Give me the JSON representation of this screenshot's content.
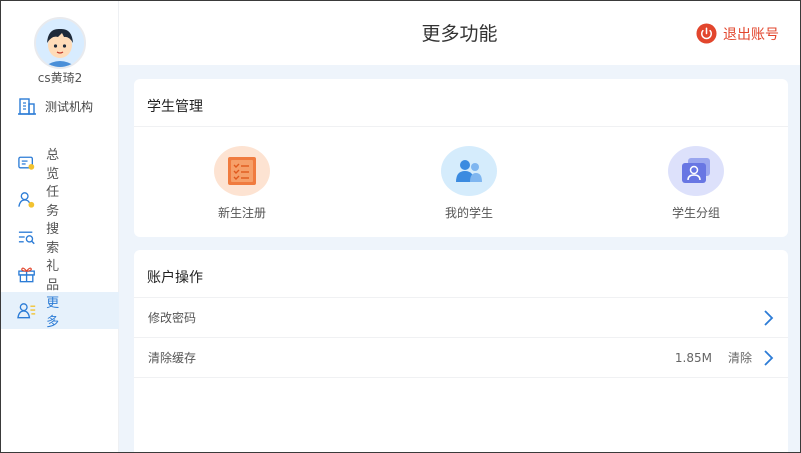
{
  "sidebar": {
    "username": "cs黄琦2",
    "org_name": "测试机构",
    "items": [
      {
        "label": "总览"
      },
      {
        "label": "任务"
      },
      {
        "label": "搜索"
      },
      {
        "label": "礼品"
      },
      {
        "label": "更多"
      }
    ]
  },
  "header": {
    "title": "更多功能",
    "logout_label": "退出账号"
  },
  "student_management": {
    "title": "学生管理",
    "features": [
      {
        "label": "新生注册"
      },
      {
        "label": "我的学生"
      },
      {
        "label": "学生分组"
      }
    ]
  },
  "account": {
    "title": "账户操作",
    "rows": [
      {
        "label": "修改密码"
      },
      {
        "label": "清除缓存",
        "value": "1.85M",
        "action": "清除"
      }
    ]
  },
  "colors": {
    "accent": "#2c7cd6",
    "logout": "#e2462d",
    "background": "#eef4fb"
  }
}
